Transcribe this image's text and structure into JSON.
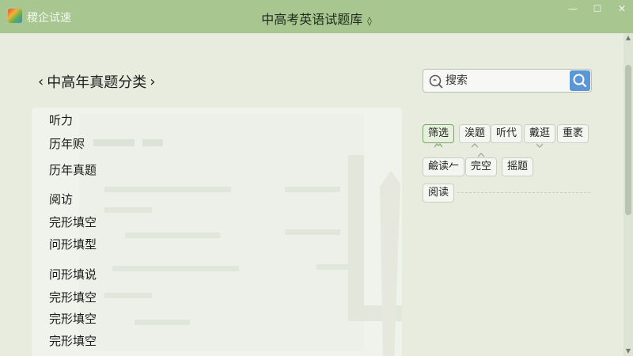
{
  "titlebar": {
    "app_name": "稷企试速",
    "window_title": "中高考英语试题库",
    "title_mark": "◊",
    "minimize": "—",
    "maximize": "☐",
    "close": "✕"
  },
  "breadcrumb": {
    "prev_arrow": "‹",
    "title": "中高年真题分类",
    "next_arrow": "›"
  },
  "search": {
    "placeholder": "搜索",
    "value": ""
  },
  "categories": [
    "听力",
    "历年赆",
    "历年真题",
    "阅访",
    "完形填空",
    "问形填型",
    "问形填说",
    "完形填空",
    "完形填空",
    "完形填空"
  ],
  "filters": {
    "chips": [
      "筛选",
      "涘题",
      "听代",
      "戴逛",
      "重袤",
      "鹼读𠂉",
      "完空",
      "摇题",
      "阅读"
    ]
  },
  "colors": {
    "titlebar": "#a7c690",
    "accent_blue": "#5b97d6",
    "active_chip": "#7aa768"
  }
}
